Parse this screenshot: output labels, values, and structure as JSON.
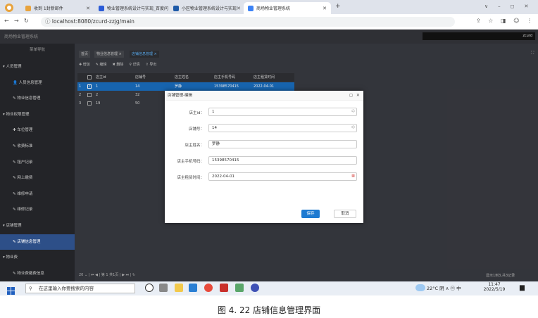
{
  "browser": {
    "tabs": [
      {
        "label": "收到 1封新邮件",
        "color": "#e8a33d"
      },
      {
        "label": "物业管理系统设计与实现_百度问",
        "color": "#2a5bd7"
      },
      {
        "label": "小区物业管理系统设计与实现",
        "color": "#1e5aa8"
      },
      {
        "label": "商场物业管理系统",
        "color": "#3b82f6"
      }
    ],
    "new_tab": "+",
    "url": "localhost:8080/zcurd-zzjg/main",
    "window_controls": [
      "∨",
      "–",
      "◻",
      "✕"
    ]
  },
  "app": {
    "title": "商场物业管理系统",
    "user": "zcurd"
  },
  "sidebar": {
    "nav_label": "菜单导航",
    "items": [
      {
        "label": "▾ 人员管理",
        "type": "group"
      },
      {
        "label": "👤 人员信息管理",
        "type": "item"
      },
      {
        "label": "✎ 物业信息管理",
        "type": "item"
      },
      {
        "label": "▾ 物业权限管理",
        "type": "group"
      },
      {
        "label": "✚ 车位管理",
        "type": "item"
      },
      {
        "label": "✎ 收费标准",
        "type": "item"
      },
      {
        "label": "✎ 租户记录",
        "type": "item"
      },
      {
        "label": "✎ 网上缴费",
        "type": "item"
      },
      {
        "label": "✎ 维修申请",
        "type": "item"
      },
      {
        "label": "✎ 维修记录",
        "type": "item"
      },
      {
        "label": "▾ 店铺管理",
        "type": "group"
      },
      {
        "label": "✎ 店铺信息管理",
        "type": "active"
      },
      {
        "label": "▾ 物业费",
        "type": "group"
      },
      {
        "label": "✎ 物业费缴费信息",
        "type": "item"
      }
    ]
  },
  "main": {
    "tabs": [
      "首页",
      "物业信息管理 ×",
      "店铺信息管理 ×"
    ],
    "toolbar": [
      "✚ 增加",
      "✎ 编辑",
      "✖ 删除",
      "⚲ 详情",
      "⇪ 导出"
    ],
    "columns": [
      "店主id",
      "店铺号",
      "店主姓名",
      "店主手机号码",
      "店主租赁时间"
    ],
    "rows": [
      {
        "n": "1",
        "cells": [
          "1",
          "14",
          "罗静",
          "15398570415",
          "2022-04-01"
        ],
        "selected": true
      },
      {
        "n": "2",
        "cells": [
          "2",
          "32",
          "",
          "",
          ""
        ],
        "selected": false
      },
      {
        "n": "3",
        "cells": [
          "19",
          "50",
          "",
          "",
          ""
        ],
        "selected": false
      }
    ],
    "pager": "20 ⌄ | ⏮ ◀ | 第 1 共1页 | ▶ ⏭ | ↻",
    "page_info": "显示1到3,共3记录"
  },
  "modal": {
    "title": "店铺管理-编辑",
    "controls": "◻ ✕",
    "fields": [
      {
        "label": "店主id：",
        "value": "1",
        "spin": true
      },
      {
        "label": "店铺号：",
        "value": "14",
        "spin": true
      },
      {
        "label": "店主姓名：",
        "value": "罗静",
        "spin": false
      },
      {
        "label": "店主手机号码：",
        "value": "15398570415",
        "spin": false
      },
      {
        "label": "店主租赁时间：",
        "value": "2022-04-01",
        "spin": false
      }
    ],
    "save": "保存",
    "cancel": "取消"
  },
  "taskbar": {
    "search_placeholder": "在这里输入你要搜索的内容",
    "weather": "22°C 阴 ∧ ㊁ 中",
    "time": "11:47",
    "date": "2022/5/19"
  },
  "caption": "图 4. 22 店铺信息管理界面"
}
